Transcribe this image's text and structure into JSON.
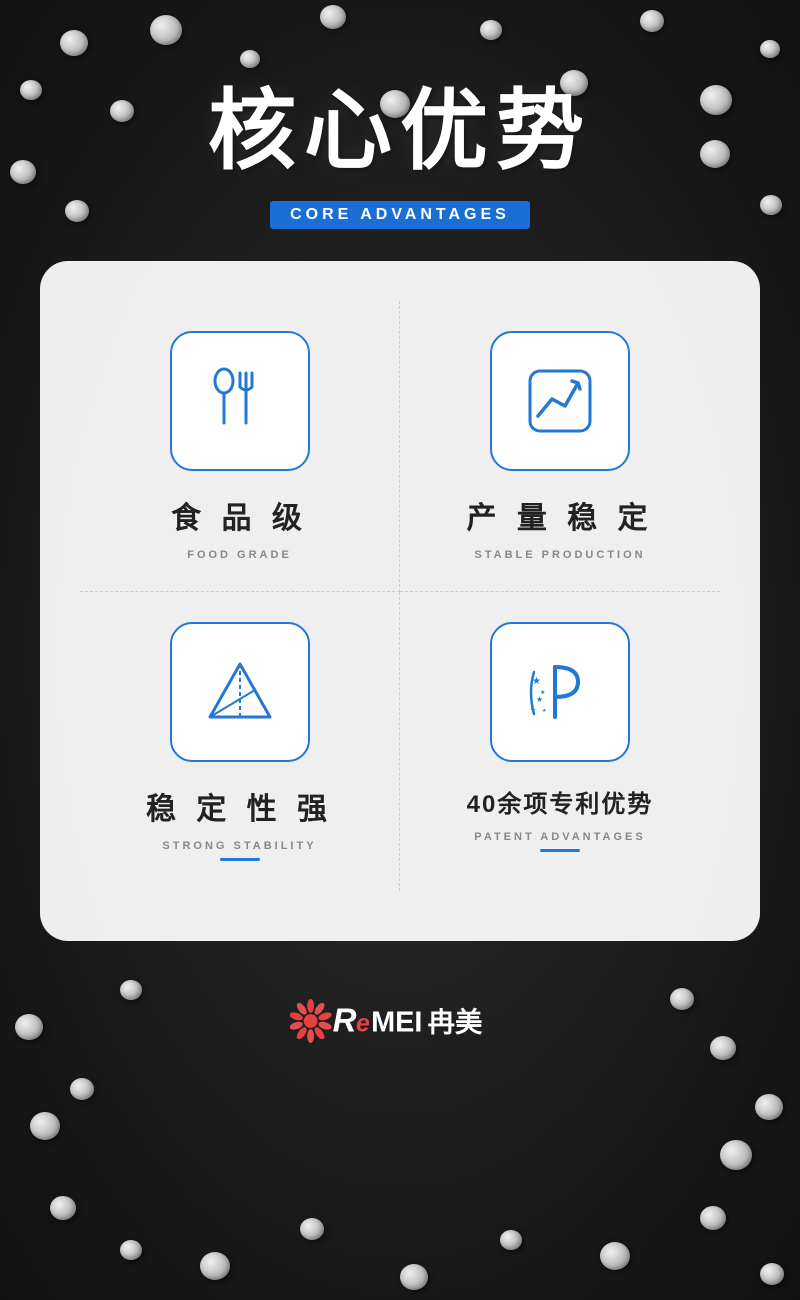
{
  "page": {
    "background_color": "#111111"
  },
  "header": {
    "main_title": "核心优势",
    "subtitle": "CORE ADVANTAGES"
  },
  "advantages": [
    {
      "id": "food-grade",
      "title_zh": "食 品 级",
      "title_en": "FOOD GRADE",
      "icon": "utensils"
    },
    {
      "id": "stable-production",
      "title_zh": "产 量 稳 定",
      "title_en": "STABLE PRODUCTION",
      "icon": "chart"
    },
    {
      "id": "strong-stability",
      "title_zh": "稳 定 性 强",
      "title_en": "STRONG STABILITY",
      "icon": "pyramid"
    },
    {
      "id": "patent",
      "title_zh": "40余项专利优势",
      "title_en": "PATENT ADVANTAGES",
      "icon": "patent"
    }
  ],
  "logo": {
    "text": "冉美",
    "brand": "REMEI"
  }
}
